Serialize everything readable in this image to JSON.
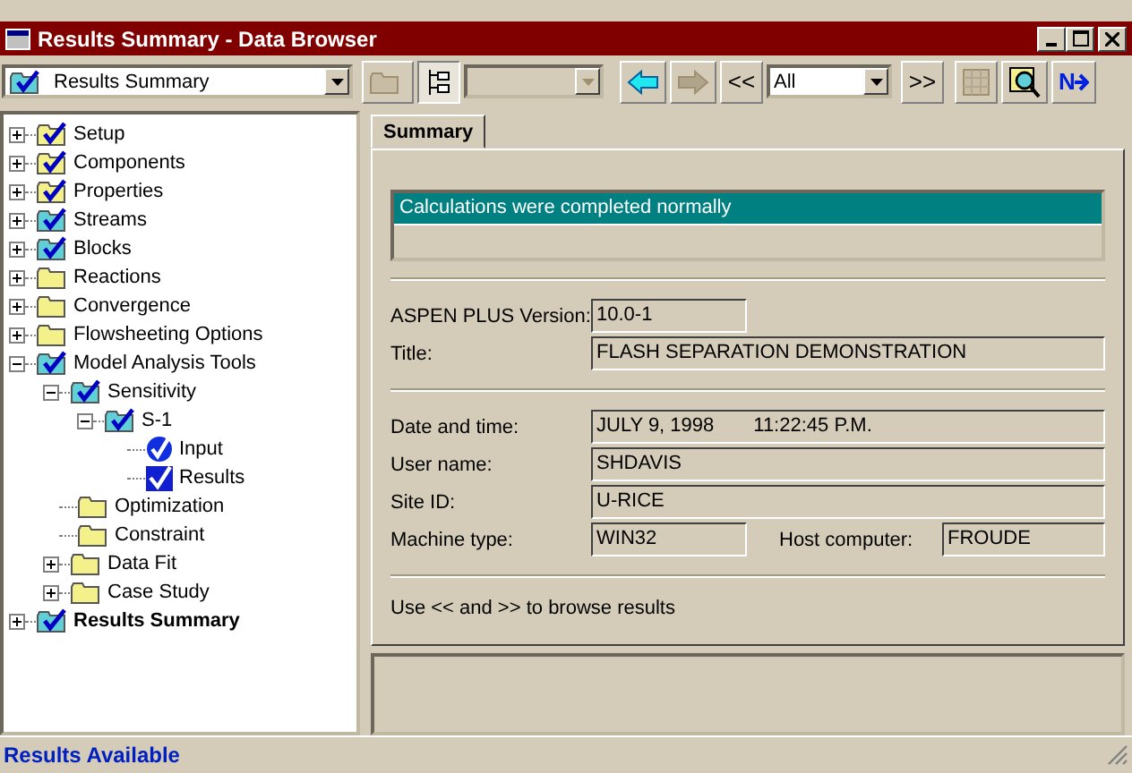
{
  "window": {
    "title": "Results Summary - Data Browser"
  },
  "toolbar": [
    {
      "kind": "object-dropdown",
      "text": "Results Summary",
      "disabled": false
    },
    {
      "kind": "folder-button",
      "disabled": true,
      "pressed": false
    },
    {
      "kind": "tree-button",
      "disabled": false,
      "pressed": true
    },
    {
      "kind": "dropdown",
      "disabled": true
    },
    {
      "kind": "back-button",
      "disabled": false,
      "pressed": false
    },
    {
      "kind": "forward-button",
      "disabled": true,
      "pressed": false
    },
    {
      "kind": "text-button",
      "text": "<<",
      "disabled": false,
      "pressed": false
    },
    {
      "kind": "dropdown",
      "text": "All",
      "disabled": false
    },
    {
      "kind": "text-button",
      "text": ">>",
      "disabled": false,
      "pressed": false
    },
    {
      "kind": "grid-button",
      "disabled": true,
      "pressed": false
    },
    {
      "kind": "find-button",
      "disabled": false,
      "pressed": false
    },
    {
      "kind": "next-button",
      "text": "N",
      "disabled": false,
      "pressed": false
    }
  ],
  "tree": [
    {
      "label": "Setup",
      "kind": "input-folder",
      "expandable": true,
      "expanded": false,
      "current": false
    },
    {
      "label": "Components",
      "kind": "input-folder",
      "expandable": true,
      "expanded": false,
      "current": false
    },
    {
      "label": "Properties",
      "kind": "input-folder",
      "expandable": true,
      "expanded": false,
      "current": false
    },
    {
      "label": "Streams",
      "kind": "result-folder",
      "expandable": true,
      "expanded": false,
      "current": false
    },
    {
      "label": "Blocks",
      "kind": "result-folder",
      "expandable": true,
      "expanded": false,
      "current": false
    },
    {
      "label": "Reactions",
      "kind": "folder",
      "expandable": true,
      "expanded": false,
      "current": false
    },
    {
      "label": "Convergence",
      "kind": "folder",
      "expandable": true,
      "expanded": false,
      "current": false
    },
    {
      "label": "Flowsheeting Options",
      "kind": "folder",
      "expandable": true,
      "expanded": false,
      "current": false
    },
    {
      "label": "Model Analysis Tools",
      "kind": "result-folder",
      "expandable": true,
      "expanded": true,
      "current": false,
      "children": [
        {
          "label": "Sensitivity",
          "kind": "result-folder",
          "expandable": true,
          "expanded": true,
          "current": false,
          "children": [
            {
              "label": "S-1",
              "kind": "result-folder",
              "expandable": true,
              "expanded": true,
              "current": false,
              "children": [
                {
                  "label": "Input",
                  "kind": "input-form",
                  "expandable": false,
                  "current": false
                },
                {
                  "label": "Results",
                  "kind": "result-form",
                  "expandable": false,
                  "current": false
                }
              ]
            }
          ]
        },
        {
          "label": "Optimization",
          "kind": "folder",
          "expandable": false,
          "current": false
        },
        {
          "label": "Constraint",
          "kind": "folder",
          "expandable": false,
          "current": false
        },
        {
          "label": "Data Fit",
          "kind": "folder",
          "expandable": true,
          "expanded": false,
          "current": false
        },
        {
          "label": "Case Study",
          "kind": "folder",
          "expandable": true,
          "expanded": false,
          "current": false
        }
      ]
    },
    {
      "label": "Results Summary",
      "kind": "result-folder",
      "expandable": true,
      "expanded": false,
      "current": true
    }
  ],
  "tabs": [
    {
      "label": "Summary",
      "selected": true
    }
  ],
  "summary": {
    "status_lines": [
      "Calculations were completed normally"
    ],
    "fields_1": [
      {
        "label": "ASPEN PLUS Version:",
        "value": "10.0-1",
        "short": true
      },
      {
        "label": "Title:",
        "value": "FLASH SEPARATION DEMONSTRATION",
        "short": false
      }
    ],
    "fields_2": [
      {
        "label": "Date and time:",
        "value": "JULY 9, 1998",
        "value_2": "11:22:45 P.M.",
        "short": false
      },
      {
        "label": "User name:",
        "value": "SHDAVIS",
        "short": false
      },
      {
        "label": "Site ID:",
        "value": "U-RICE",
        "short": false
      },
      {
        "label": "Machine type:",
        "value": "WIN32",
        "short": true,
        "extra_label": "Host computer:",
        "extra_value": "FROUDE"
      }
    ],
    "hint": "Use << and >> to browse results"
  },
  "status_bar": {
    "text": "Results Available"
  }
}
